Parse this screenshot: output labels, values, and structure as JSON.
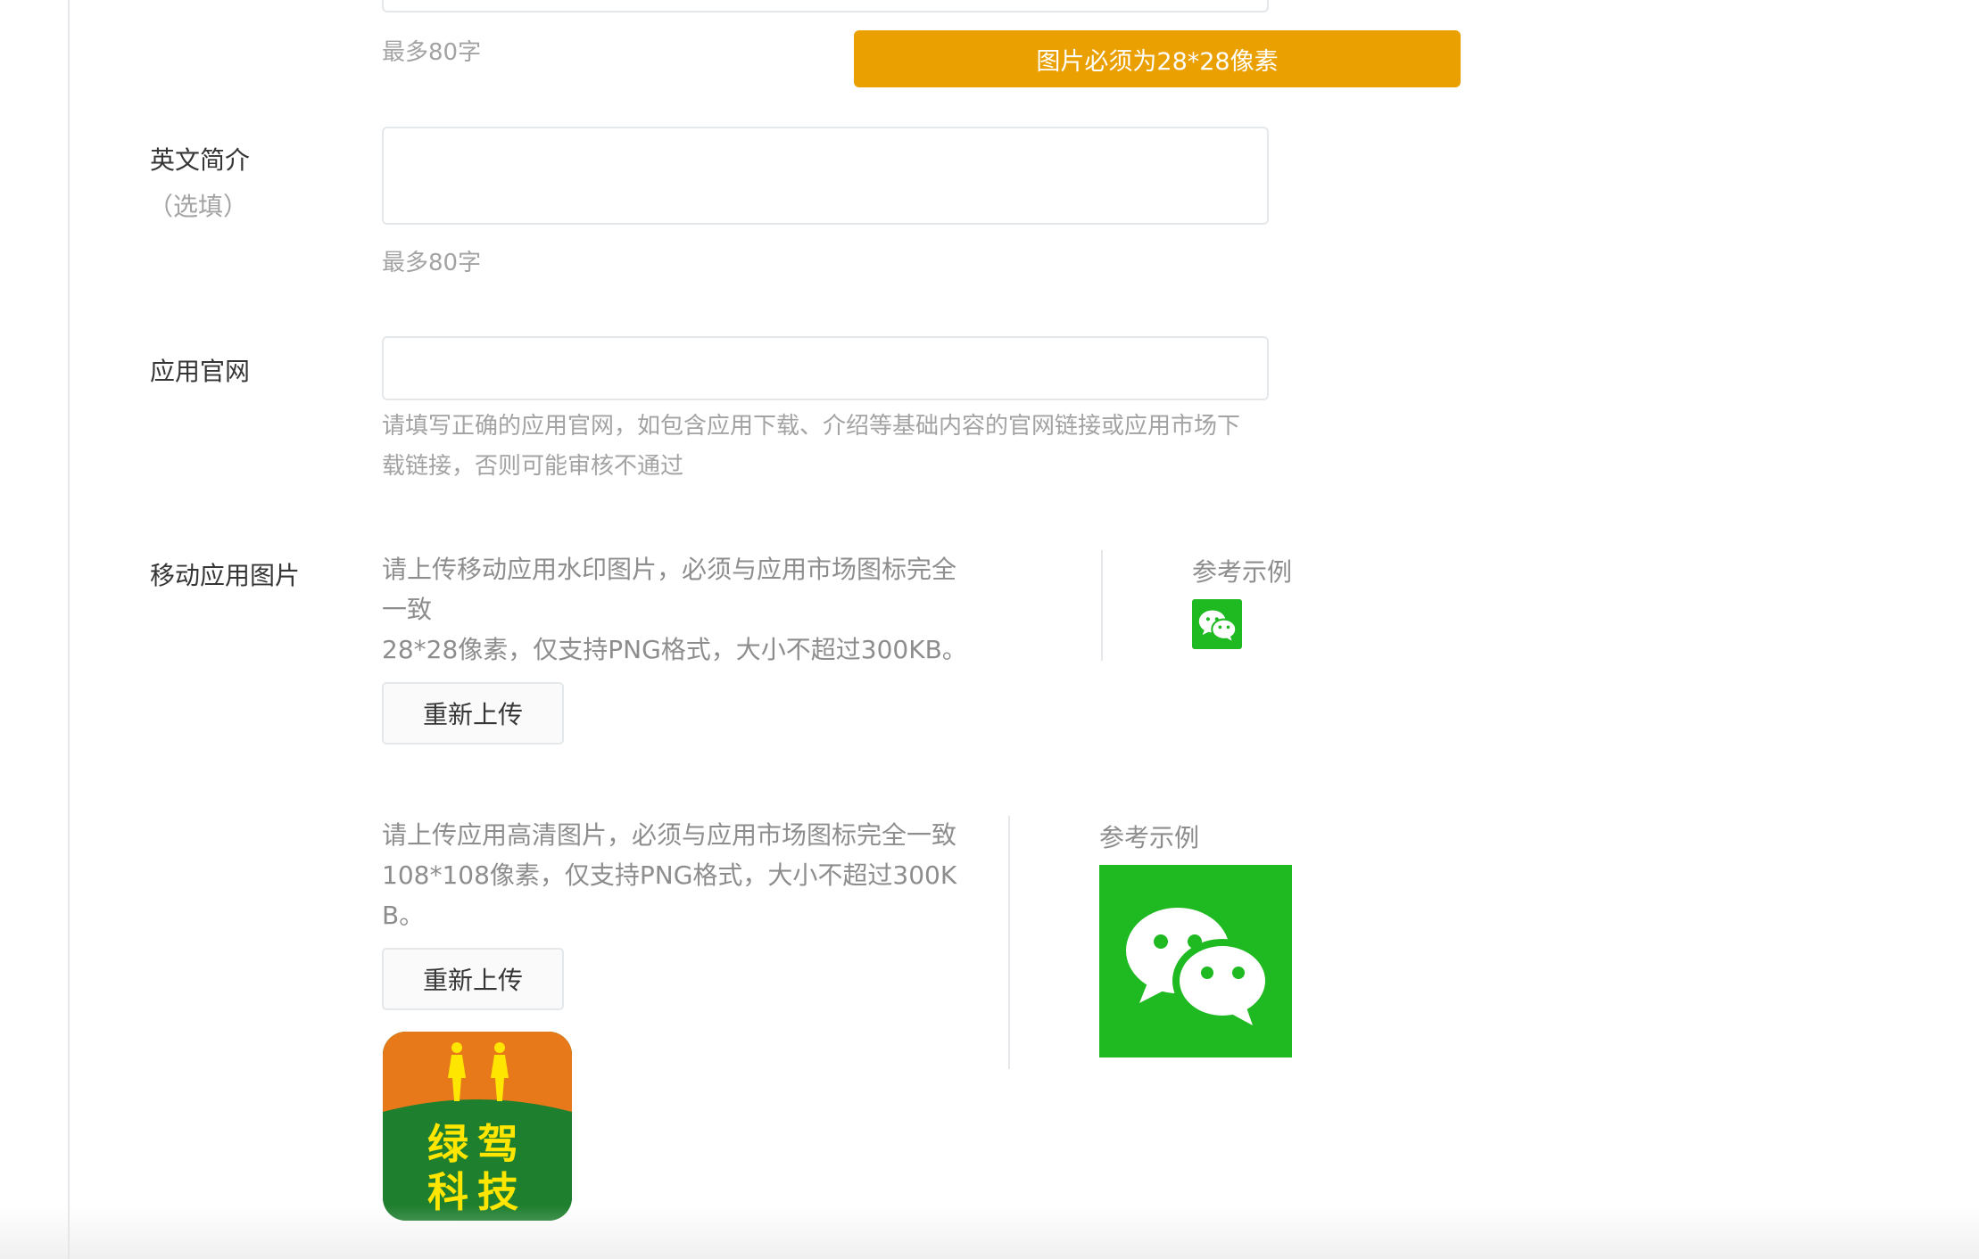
{
  "top_field": {
    "hint": "最多80字"
  },
  "toast": {
    "message": "图片必须为28*28像素"
  },
  "english_intro": {
    "label": "英文简介",
    "optional": "（选填）",
    "hint": "最多80字"
  },
  "website": {
    "label": "应用官网",
    "hint_line1": "请填写正确的应用官网，如包含应用下载、介绍等基础内容的官网链接或应用市场下",
    "hint_line2": "载链接，否则可能审核不通过"
  },
  "mobile_image": {
    "label": "移动应用图片",
    "small": {
      "desc_line1": "请上传移动应用水印图片，必须与应用市场图标完全",
      "desc_line2": "一致",
      "desc_line3": "28*28像素，仅支持PNG格式，大小不超过300KB。",
      "button": "重新上传",
      "ref_title": "参考示例"
    },
    "large": {
      "desc_line1": "请上传应用高清图片，必须与应用市场图标完全一致",
      "desc_line2": "108*108像素，仅支持PNG格式，大小不超过300K",
      "desc_line3": "B。",
      "button": "重新上传",
      "ref_title": "参考示例",
      "uploaded_logo_text_line1": "绿驾",
      "uploaded_logo_text_line2": "科技"
    }
  },
  "colors": {
    "toast": "#e9a000",
    "wechat_green": "#1fb922",
    "logo_orange": "#e8791a",
    "logo_green": "#1e7f2e",
    "logo_text": "#ffe600"
  }
}
